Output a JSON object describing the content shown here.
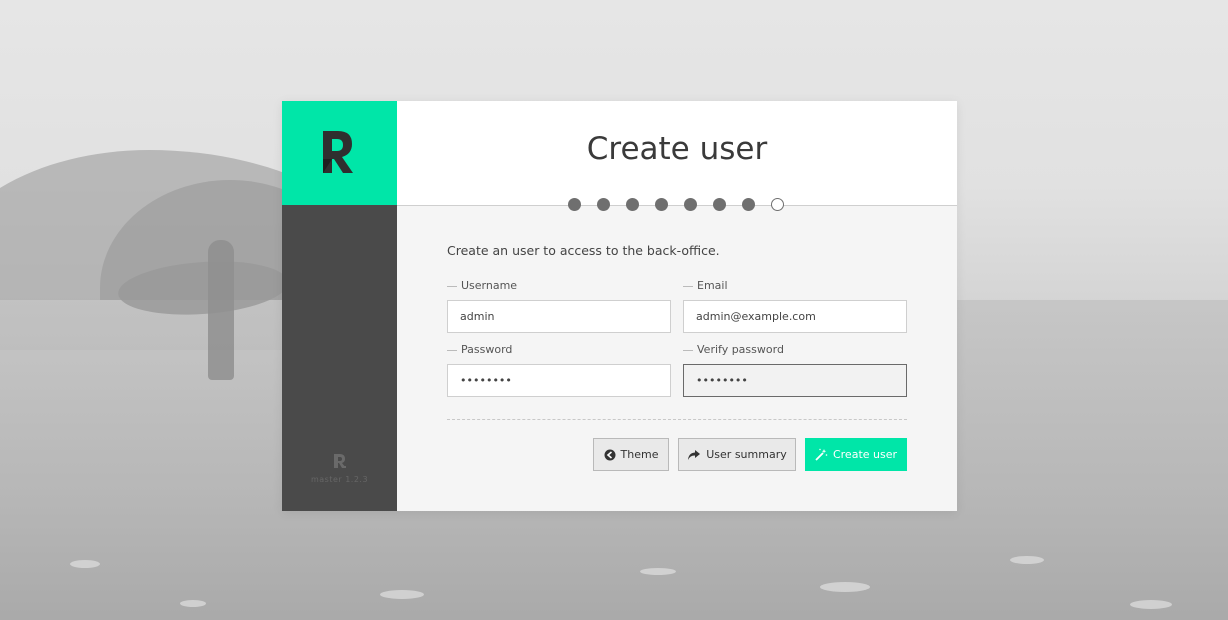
{
  "brand": {
    "accent_color": "#00e6a8",
    "logo_letter": "R",
    "version": "master 1.2.3"
  },
  "header": {
    "title": "Create user",
    "steps_total": 8,
    "steps_completed": 7,
    "current_step": 8
  },
  "form": {
    "intro": "Create an user to access to the back-office.",
    "username": {
      "label": "Username",
      "value": "admin"
    },
    "email": {
      "label": "Email",
      "value": "admin@example.com"
    },
    "password": {
      "label": "Password",
      "value": "••••••••"
    },
    "verify_password": {
      "label": "Verify password",
      "value": "••••••••"
    }
  },
  "actions": {
    "theme_label": "Theme",
    "theme_icon": "arrow-circle-left-icon",
    "summary_label": "User summary",
    "summary_icon": "share-arrow-icon",
    "create_label": "Create user",
    "create_icon": "magic-wand-icon"
  }
}
